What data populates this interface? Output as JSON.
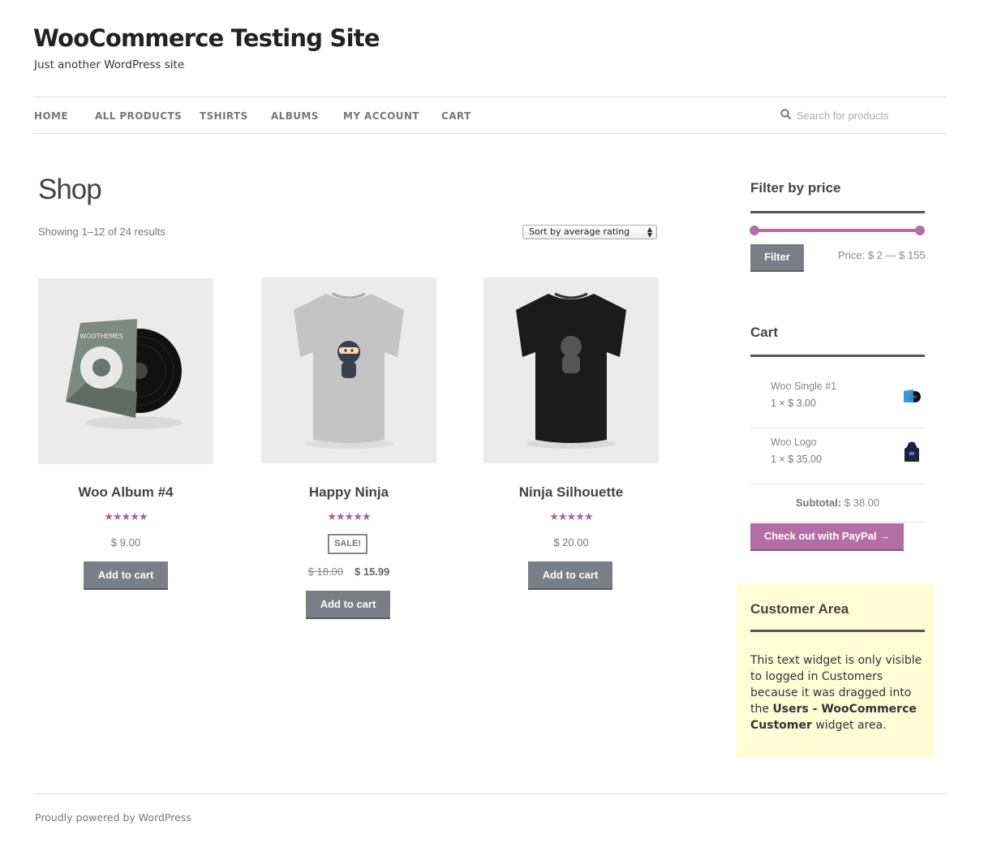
{
  "site": {
    "title": "WooCommerce Testing Site",
    "description": "Just another WordPress site"
  },
  "nav": {
    "items": [
      "HOME",
      "ALL PRODUCTS",
      "TSHIRTS",
      "ALBUMS",
      "MY ACCOUNT",
      "CART"
    ],
    "search_placeholder": "Search for products"
  },
  "shop": {
    "title": "Shop",
    "result_count": "Showing 1–12 of 24 results",
    "sort_selected": "Sort by average rating"
  },
  "products": [
    {
      "name": "Woo Album #4",
      "rating_stars": "★★★★★",
      "price": "$ 9.00",
      "button": "Add to cart"
    },
    {
      "name": "Happy Ninja",
      "rating_stars": "★★★★★",
      "sale_badge": "SALE!",
      "old_price": "$ 18.00",
      "price": "$ 15.99",
      "button": "Add to cart"
    },
    {
      "name": "Ninja Silhouette",
      "rating_stars": "★★★★★",
      "price": "$ 20.00",
      "button": "Add to cart"
    }
  ],
  "filter": {
    "title": "Filter by price",
    "button": "Filter",
    "price_text": "Price: $ 2 — $ 155"
  },
  "cart": {
    "title": "Cart",
    "items": [
      {
        "name": "Woo Single #1",
        "qty": "1 × $ 3.00"
      },
      {
        "name": "Woo Logo",
        "qty": "1 × $ 35.00"
      }
    ],
    "subtotal_label": "Subtotal:",
    "subtotal_value": "$ 38.00",
    "checkout_button": "Check out with PayPal →"
  },
  "customer_area": {
    "title": "Customer Area",
    "text_1": "This text widget is only visible to logged in Customers because it was dragged into the ",
    "text_bold": "Users - WooCommerce Customer",
    "text_2": " widget area."
  },
  "footer": {
    "text": "Proudly powered by WordPress"
  },
  "colors": {
    "accent": "#b46ea6",
    "button": "#7a7e87",
    "customer_bg": "#fffcd6"
  }
}
